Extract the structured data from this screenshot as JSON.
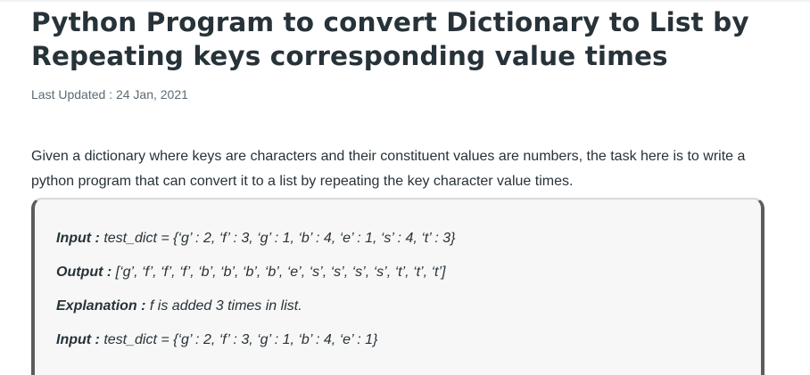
{
  "article": {
    "title": "Python Program to convert Dictionary to List by Repeating keys corresponding value times",
    "last_updated": "Last Updated : 24 Jan, 2021",
    "intro": "Given a dictionary where keys are characters and their constituent values are numbers, the task here is to write a python program that can convert it to a list by repeating the key character value times."
  },
  "example": {
    "lines": [
      {
        "key": "Input :",
        "value": " test_dict = {‘g’ : 2, ‘f’ : 3, ‘g’ : 1, ‘b’ : 4, ‘e’ : 1, ‘s’ : 4, ‘t’ : 3}"
      },
      {
        "key": "Output :",
        "value": " [‘g’, ‘f’, ‘f’, ‘f’, ‘b’, ‘b’, ‘b’, ‘b’, ‘e’, ‘s’, ‘s’, ‘s’, ‘s’, ‘t’, ‘t’, ‘t’]"
      },
      {
        "key": "Explanation :",
        "value": " f is added 3 times in list."
      },
      {
        "key": "Input :",
        "value": " test_dict = {‘g’ : 2, ‘f’ : 3, ‘g’ : 1, ‘b’ : 4, ‘e’ : 1}"
      }
    ]
  },
  "colors": {
    "text": "#273239",
    "meta": "#5c6a72",
    "box_bg": "#f7f7f7",
    "box_border": "#5c5c5c"
  }
}
